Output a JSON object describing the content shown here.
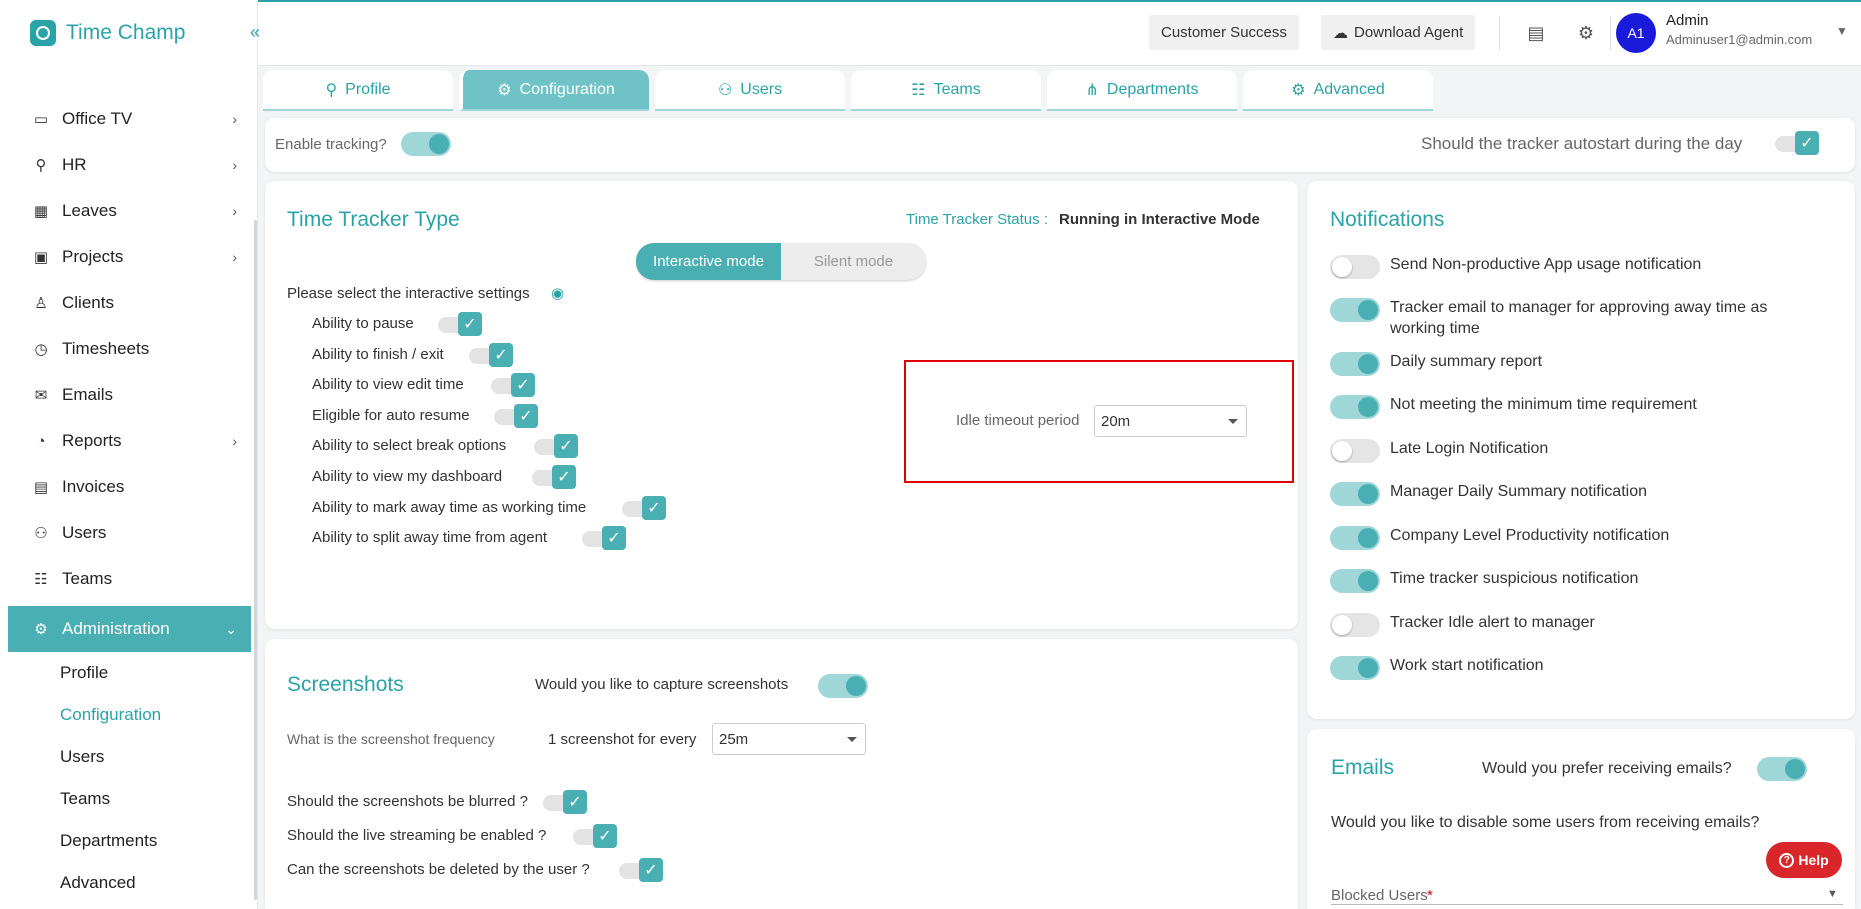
{
  "app": {
    "name": "Time Champ",
    "collapse_icon": "double-chevron-left-icon"
  },
  "sidebar": {
    "items": [
      {
        "label": "Office TV",
        "icon": "tv-icon",
        "chevron": true
      },
      {
        "label": "HR",
        "icon": "person-icon",
        "chevron": true
      },
      {
        "label": "Leaves",
        "icon": "calendar-icon",
        "chevron": true
      },
      {
        "label": "Projects",
        "icon": "briefcase-icon",
        "chevron": true
      },
      {
        "label": "Clients",
        "icon": "client-icon",
        "chevron": false
      },
      {
        "label": "Timesheets",
        "icon": "alarm-icon",
        "chevron": false
      },
      {
        "label": "Emails",
        "icon": "mail-icon",
        "chevron": false
      },
      {
        "label": "Reports",
        "icon": "pie-chart-icon",
        "chevron": true
      },
      {
        "label": "Invoices",
        "icon": "invoice-icon",
        "chevron": false
      },
      {
        "label": "Users",
        "icon": "users-icon",
        "chevron": false
      },
      {
        "label": "Teams",
        "icon": "teams-icon",
        "chevron": false
      }
    ],
    "active": {
      "label": "Administration",
      "icon": "gear-icon"
    },
    "subitems": [
      "Profile",
      "Configuration",
      "Users",
      "Teams",
      "Departments",
      "Advanced"
    ],
    "selected_sub": "Configuration"
  },
  "header": {
    "customer_success": "Customer Success",
    "download_agent": "Download Agent",
    "user": {
      "initials": "A1",
      "name": "Admin",
      "email": "Adminuser1@admin.com"
    }
  },
  "tabs": [
    {
      "label": "Profile",
      "icon": "person-icon"
    },
    {
      "label": "Configuration",
      "icon": "gears-icon",
      "active": true
    },
    {
      "label": "Users",
      "icon": "users-icon"
    },
    {
      "label": "Teams",
      "icon": "teams-icon"
    },
    {
      "label": "Departments",
      "icon": "org-chart-icon"
    },
    {
      "label": "Advanced",
      "icon": "advanced-gear-icon"
    }
  ],
  "tracking": {
    "enable_label": "Enable tracking?",
    "autostart_label": "Should the tracker autostart during the day"
  },
  "tracker_type": {
    "title": "Time Tracker Type",
    "status_label": "Time Tracker Status :",
    "status_value": "Running in Interactive Mode",
    "modes": [
      "Interactive mode",
      "Silent mode"
    ],
    "active_mode": "Interactive mode",
    "interactive_label": "Please select the interactive settings",
    "settings": [
      "Ability to pause",
      "Ability to finish / exit",
      "Ability to view edit time",
      "Eligible for auto resume",
      "Ability to select break options",
      "Ability to view my dashboard",
      "Ability to mark away time as working time",
      "Ability to split away time from agent"
    ],
    "idle_label": "Idle timeout period",
    "idle_value": "20m"
  },
  "screenshots": {
    "title": "Screenshots",
    "capture_label": "Would you like to capture screenshots",
    "frequency_label": "What is the screenshot frequency",
    "every_label": "1 screenshot for every",
    "every_value": "25m",
    "options": [
      "Should the screenshots be blurred ?",
      "Should the live streaming be enabled ?",
      "Can the screenshots be deleted by the user ?"
    ]
  },
  "notifications": {
    "title": "Notifications",
    "items": [
      {
        "label": "Send Non-productive App usage notification",
        "on": false
      },
      {
        "label": "Tracker email to manager for approving away time as working time",
        "on": true
      },
      {
        "label": "Daily summary report",
        "on": true
      },
      {
        "label": "Not meeting the minimum time requirement",
        "on": true
      },
      {
        "label": "Late Login Notification",
        "on": false
      },
      {
        "label": "Manager Daily Summary notification",
        "on": true
      },
      {
        "label": "Company Level Productivity notification",
        "on": true
      },
      {
        "label": "Time tracker suspicious notification",
        "on": true
      },
      {
        "label": "Tracker Idle alert to manager",
        "on": false
      },
      {
        "label": "Work start notification",
        "on": true
      }
    ]
  },
  "emails": {
    "title": "Emails",
    "prefer_label": "Would you prefer receiving emails?",
    "disable_label": "Would you like to disable some users from receiving emails?",
    "blocked_label": "Blocked Users",
    "required_mark": "*"
  },
  "help": {
    "label": "Help"
  },
  "colors": {
    "accent": "#29a3a7",
    "accent_light": "#9fd6d8",
    "active_bg": "#4aafb2",
    "help_red": "#d9262b",
    "highlight_red": "#e00000",
    "avatar_blue": "#1a1adb"
  }
}
